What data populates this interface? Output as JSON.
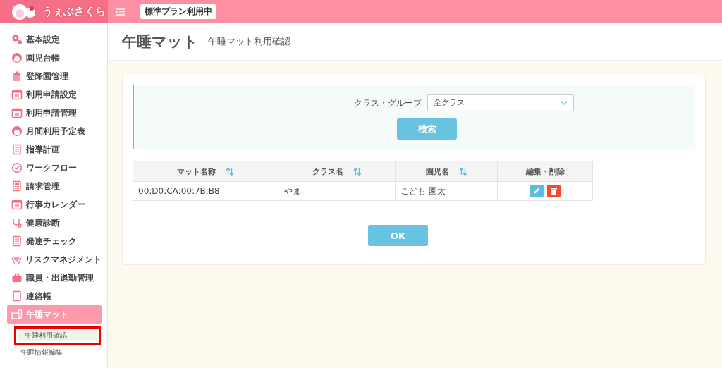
{
  "header": {
    "logo_text": "うぇぶさくら",
    "plan_badge": "標準プラン利用中"
  },
  "sidebar": {
    "items": [
      {
        "label": "基本設定",
        "selected": false
      },
      {
        "label": "園児台帳",
        "selected": false
      },
      {
        "label": "登降園管理",
        "selected": false
      },
      {
        "label": "利用申請設定",
        "selected": false
      },
      {
        "label": "利用申請管理",
        "selected": false
      },
      {
        "label": "月間利用予定表",
        "selected": false
      },
      {
        "label": "指導計画",
        "selected": false
      },
      {
        "label": "ワークフロー",
        "selected": false
      },
      {
        "label": "請求管理",
        "selected": false
      },
      {
        "label": "行事カレンダー",
        "selected": false
      },
      {
        "label": "健康診断",
        "selected": false
      },
      {
        "label": "発達チェック",
        "selected": false
      },
      {
        "label": "リスクマネジメント",
        "selected": false
      },
      {
        "label": "職員・出退勤管理",
        "selected": false
      },
      {
        "label": "連絡帳",
        "selected": false
      },
      {
        "label": "午睡マット",
        "selected": true,
        "children": [
          {
            "label": "午睡利用確認",
            "selected": true
          },
          {
            "label": "午睡情報編集",
            "selected": false
          }
        ]
      }
    ]
  },
  "page": {
    "title": "午睡マット",
    "subtitle": "午睡マット利用確認"
  },
  "filter": {
    "label": "クラス・グループ",
    "select_value": "全クラス",
    "search_button": "検索"
  },
  "table": {
    "columns": [
      {
        "label": "マット名称",
        "sortable": true
      },
      {
        "label": "クラス名",
        "sortable": true
      },
      {
        "label": "園児名",
        "sortable": true
      },
      {
        "label": "編集・削除",
        "sortable": false
      }
    ],
    "rows": [
      {
        "cells": [
          "00:D0:CA:00:7B:B8",
          "やま",
          "こども 園太"
        ]
      }
    ]
  },
  "ok_button": "OK"
}
